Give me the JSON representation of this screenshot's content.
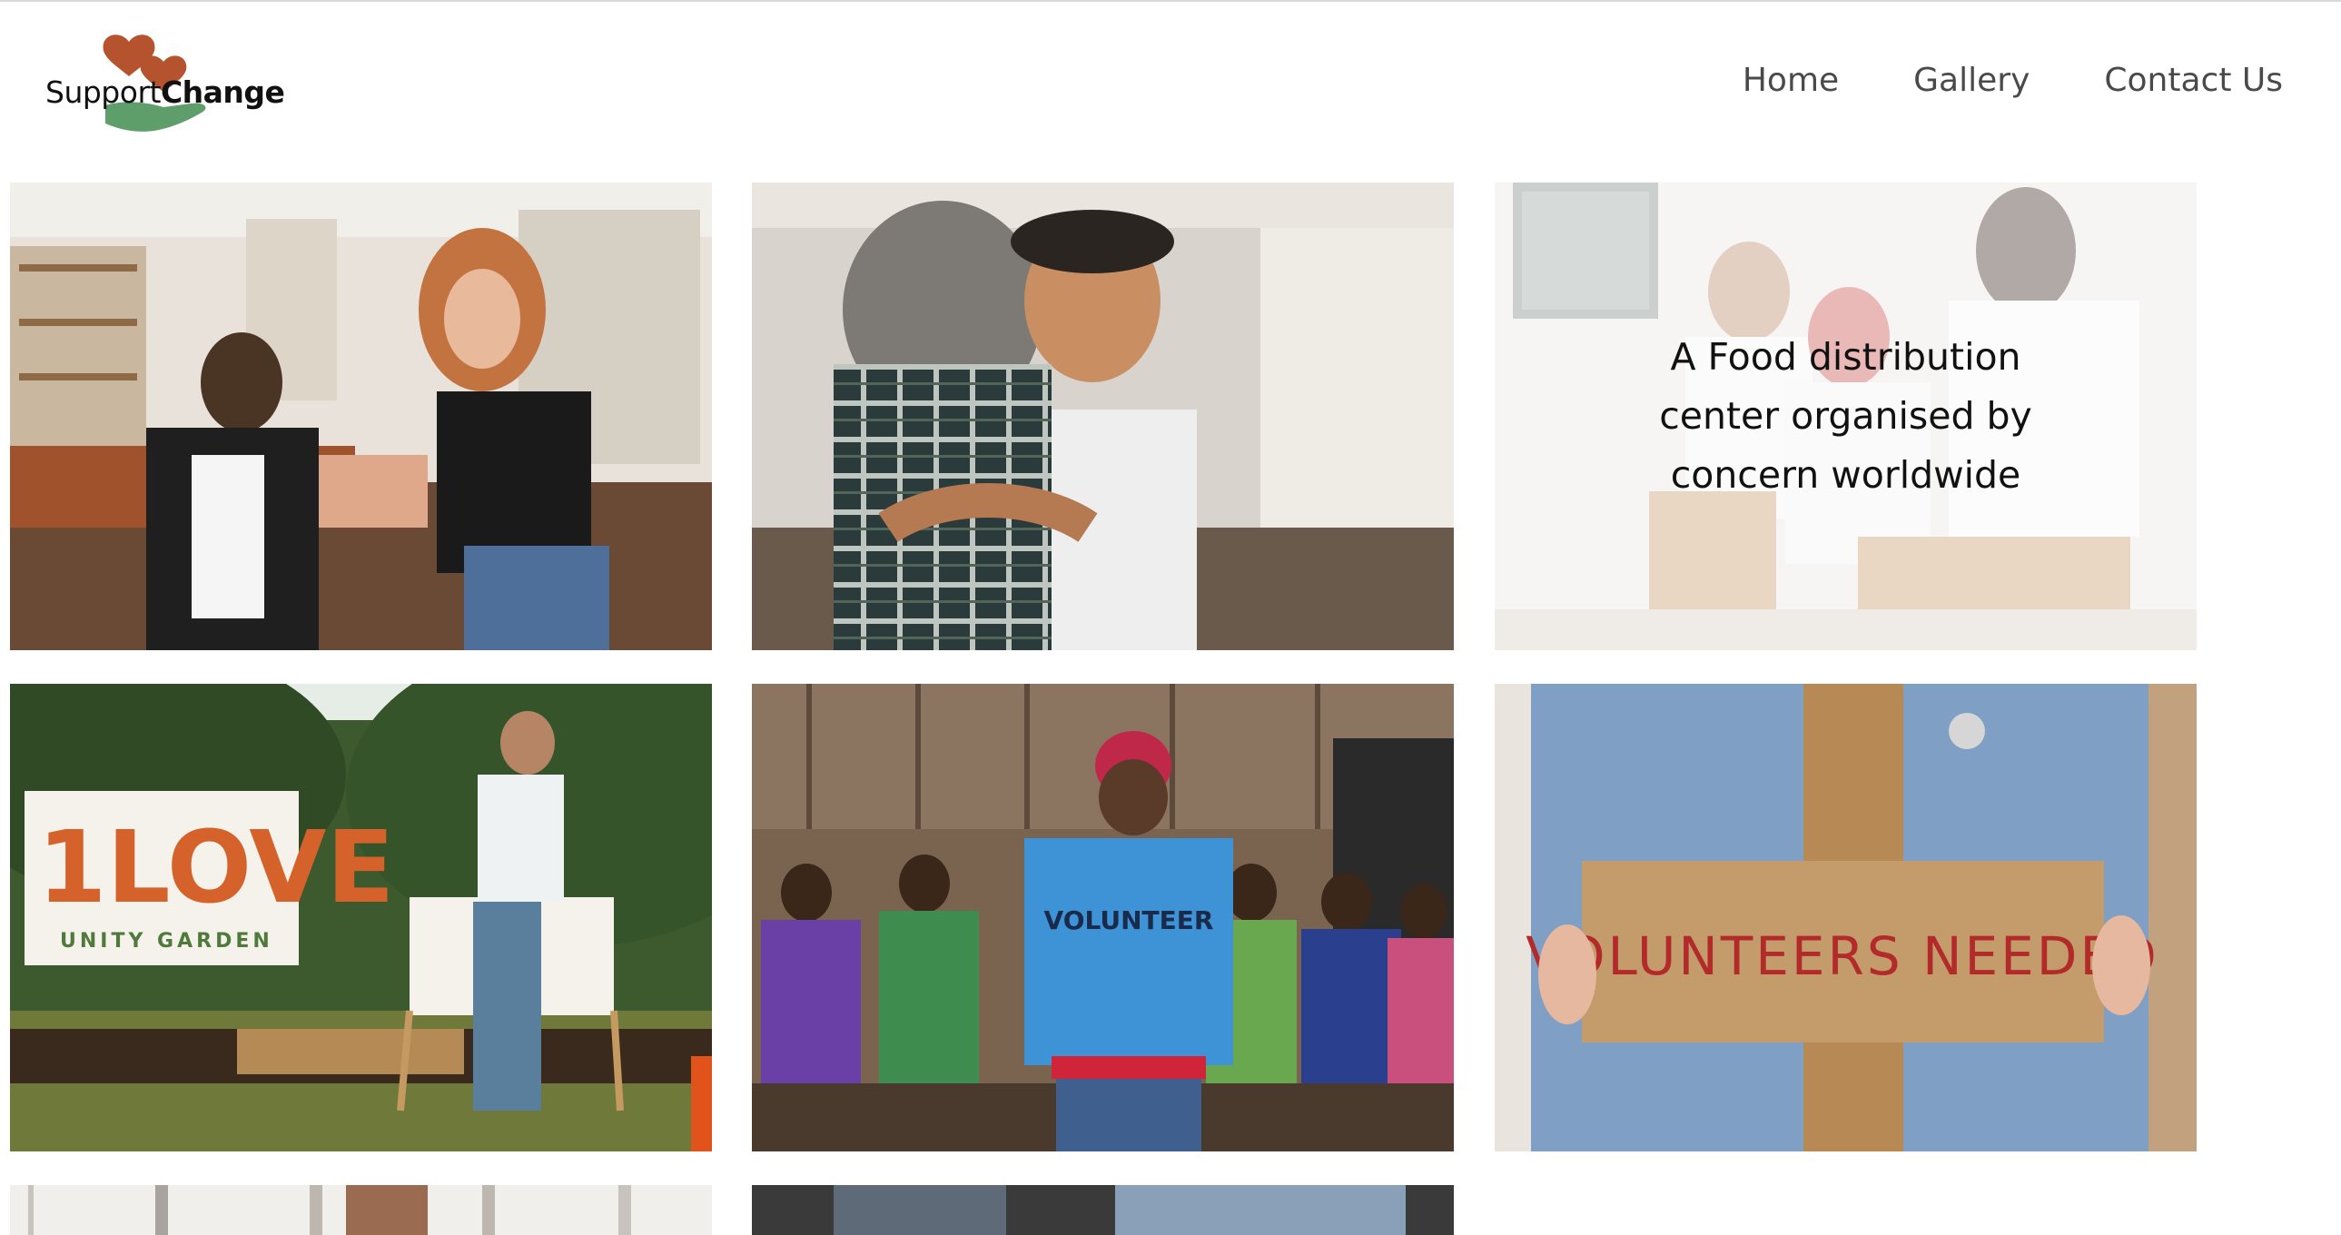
{
  "brand": {
    "name_light": "Support",
    "name_bold": "Change",
    "logo_icon": "hearts-and-hand-icon",
    "colors": {
      "heart": "#b5532e",
      "hand": "#5e9e6b",
      "text": "#111111"
    }
  },
  "nav": {
    "items": [
      "Home",
      "Gallery",
      "Contact Us"
    ]
  },
  "gallery": {
    "tiles": [
      {
        "subject": "market-hug-photo",
        "caption": ""
      },
      {
        "subject": "embrace-photo",
        "caption": ""
      },
      {
        "subject": "food-distribution-photo",
        "caption": "A Food distribution center organised by concern worldwide"
      },
      {
        "subject": "unity-garden-photo",
        "caption": ""
      },
      {
        "subject": "volunteer-children-photo",
        "caption": ""
      },
      {
        "subject": "volunteers-needed-photo",
        "caption": ""
      },
      {
        "subject": "window-room-photo",
        "caption": ""
      },
      {
        "subject": "dark-portrait-photo",
        "caption": ""
      }
    ],
    "photo_text": {
      "love_sign": "1LOVE",
      "love_sign_sub": "UNITY GARDEN",
      "volunteer_shirt": "VOLUNTEER",
      "cardboard_sign": "VOLUNTEERS NEEDED"
    }
  }
}
